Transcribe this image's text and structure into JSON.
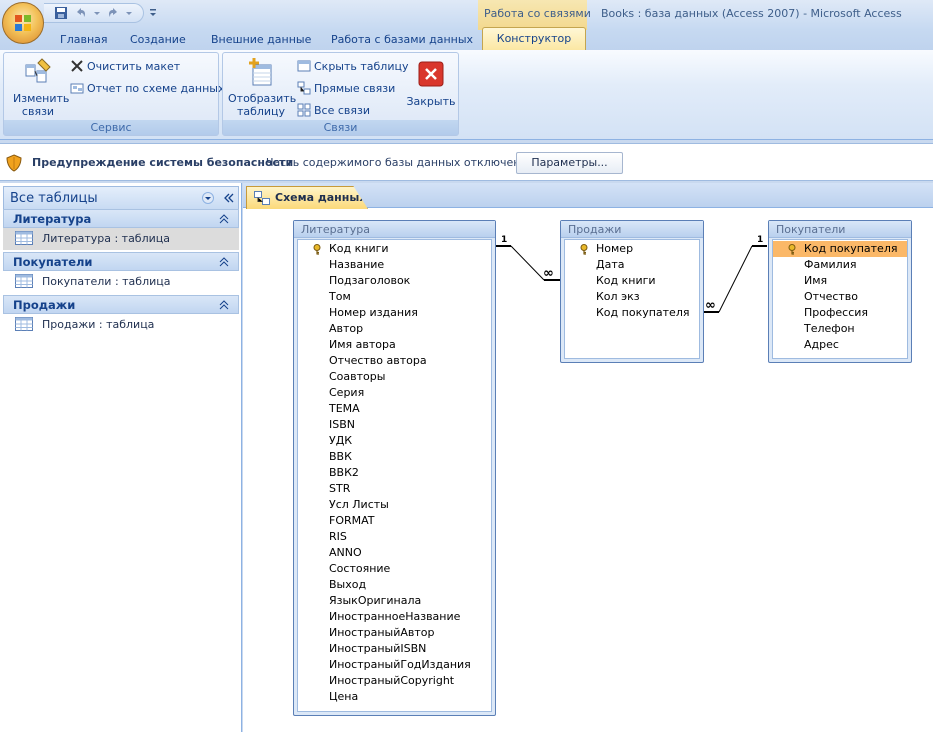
{
  "window": {
    "title": "Books : база данных (Access 2007) - Microsoft Access",
    "context_tab_group": "Работа со связями"
  },
  "ribbon": {
    "tabs": [
      "Главная",
      "Создание",
      "Внешние данные",
      "Работа с базами данных"
    ],
    "active_tab": "Конструктор",
    "groups": {
      "service": {
        "title": "Сервис",
        "edit_links": "Изменить связи",
        "clear_layout": "Очистить макет",
        "report": "Отчет по схеме данных"
      },
      "links": {
        "title": "Связи",
        "show_table": "Отобразить таблицу",
        "hide_table": "Скрыть таблицу",
        "direct_links": "Прямые связи",
        "all_links": "Все связи",
        "close": "Закрыть"
      }
    }
  },
  "security_bar": {
    "title": "Предупреждение системы безопасности",
    "message": "Часть содержимого базы данных отключено",
    "button": "Параметры..."
  },
  "nav": {
    "header": "Все таблицы",
    "groups": [
      {
        "name": "Литература",
        "item": "Литература : таблица"
      },
      {
        "name": "Покупатели",
        "item": "Покупатели : таблица"
      },
      {
        "name": "Продажи",
        "item": "Продажи : таблица"
      }
    ]
  },
  "document": {
    "tab": "Схема данных",
    "tables": {
      "literature": {
        "title": "Литература",
        "fields": [
          "Код книги",
          "Название",
          "Подзаголовок",
          "Том",
          "Номер издания",
          "Автор",
          "Имя автора",
          "Отчество автора",
          "Соавторы",
          "Серия",
          "ТЕМА",
          "ISBN",
          "УДК",
          "ВВК",
          "ВВК2",
          "STR",
          "Усл Листы",
          "FORMAT",
          "RIS",
          "ANNO",
          "Состояние",
          "Выход",
          "ЯзыкОригинала",
          "ИностранноеНазвание",
          "ИностраныйАвтор",
          "ИностраныйISBN",
          "ИностраныйГодИздания",
          "ИностраныйCopyright",
          "Цена"
        ]
      },
      "sales": {
        "title": "Продажи",
        "fields": [
          "Номер",
          "Дата",
          "Код книги",
          "Кол экз",
          "Код покупателя"
        ]
      },
      "buyers": {
        "title": "Покупатели",
        "fields": [
          "Код покупателя",
          "Фамилия",
          "Имя",
          "Отчество",
          "Профессия",
          "Телефон",
          "Адрес"
        ]
      }
    },
    "relations": [
      {
        "from": "Литература.Код книги",
        "to": "Продажи.Код книги",
        "one": "1",
        "many": "∞"
      },
      {
        "from": "Покупатели.Код покупателя",
        "to": "Продажи.Код покупателя",
        "one": "1",
        "many": "∞"
      }
    ]
  }
}
